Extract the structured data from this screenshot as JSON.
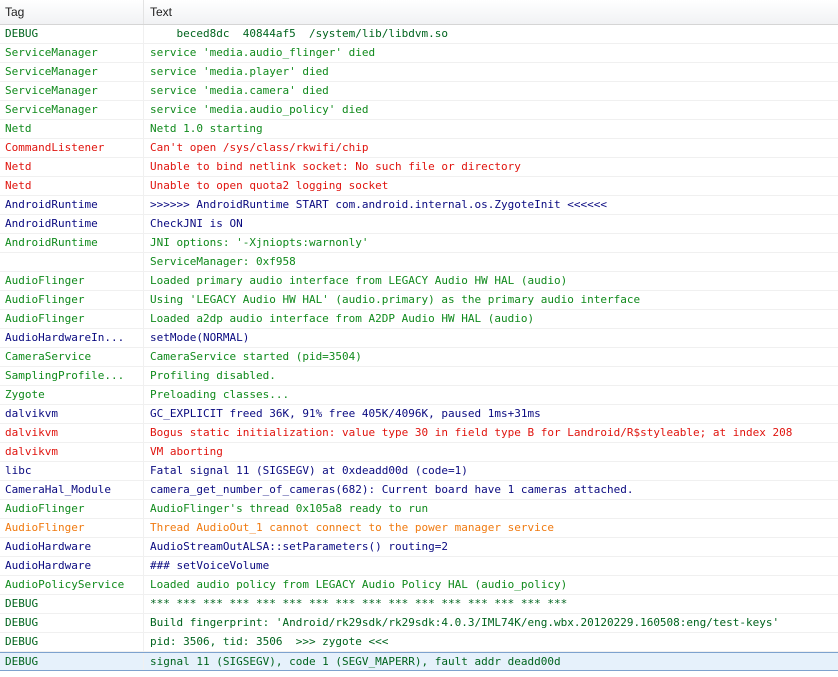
{
  "header": {
    "tag": "Tag",
    "text": "Text"
  },
  "rows": [
    {
      "tag": "DEBUG",
      "text": "    beced8dc  40844af5  /system/lib/libdvm.so",
      "level": "D"
    },
    {
      "tag": "ServiceManager",
      "text": "service 'media.audio_flinger' died",
      "level": "I"
    },
    {
      "tag": "ServiceManager",
      "text": "service 'media.player' died",
      "level": "I"
    },
    {
      "tag": "ServiceManager",
      "text": "service 'media.camera' died",
      "level": "I"
    },
    {
      "tag": "ServiceManager",
      "text": "service 'media.audio_policy' died",
      "level": "I"
    },
    {
      "tag": "Netd",
      "text": "Netd 1.0 starting",
      "level": "I"
    },
    {
      "tag": "CommandListener",
      "text": "Can't open /sys/class/rkwifi/chip",
      "level": "E"
    },
    {
      "tag": "Netd",
      "text": "Unable to bind netlink socket: No such file or directory",
      "level": "E"
    },
    {
      "tag": "Netd",
      "text": "Unable to open quota2 logging socket",
      "level": "E"
    },
    {
      "tag": "AndroidRuntime",
      "text": ">>>>>> AndroidRuntime START com.android.internal.os.ZygoteInit <<<<<<",
      "level": "V"
    },
    {
      "tag": "AndroidRuntime",
      "text": "CheckJNI is ON",
      "level": "V"
    },
    {
      "tag": "AndroidRuntime",
      "text": "JNI options: '-Xjniopts:warnonly'",
      "level": "I"
    },
    {
      "tag": "",
      "text": "ServiceManager: 0xf958",
      "level": "I"
    },
    {
      "tag": "AudioFlinger",
      "text": "Loaded primary audio interface from LEGACY Audio HW HAL (audio)",
      "level": "I"
    },
    {
      "tag": "AudioFlinger",
      "text": "Using 'LEGACY Audio HW HAL' (audio.primary) as the primary audio interface",
      "level": "I"
    },
    {
      "tag": "AudioFlinger",
      "text": "Loaded a2dp audio interface from A2DP Audio HW HAL (audio)",
      "level": "I"
    },
    {
      "tag": "AudioHardwareIn...",
      "text": "setMode(NORMAL)",
      "level": "V"
    },
    {
      "tag": "CameraService",
      "text": "CameraService started (pid=3504)",
      "level": "I"
    },
    {
      "tag": "SamplingProfile...",
      "text": "Profiling disabled.",
      "level": "I"
    },
    {
      "tag": "Zygote",
      "text": "Preloading classes...",
      "level": "I"
    },
    {
      "tag": "dalvikvm",
      "text": "GC_EXPLICIT freed 36K, 91% free 405K/4096K, paused 1ms+31ms",
      "level": "V"
    },
    {
      "tag": "dalvikvm",
      "text": "Bogus static initialization: value type 30 in field type B for Landroid/R$styleable; at index 208",
      "level": "E"
    },
    {
      "tag": "dalvikvm",
      "text": "VM aborting",
      "level": "E"
    },
    {
      "tag": "libc",
      "text": "Fatal signal 11 (SIGSEGV) at 0xdeadd00d (code=1)",
      "level": "V"
    },
    {
      "tag": "CameraHal_Module",
      "text": "camera_get_number_of_cameras(682): Current board have 1 cameras attached.",
      "level": "V"
    },
    {
      "tag": "AudioFlinger",
      "text": "AudioFlinger's thread 0x105a8 ready to run",
      "level": "I"
    },
    {
      "tag": "AudioFlinger",
      "text": "Thread AudioOut_1 cannot connect to the power manager service",
      "level": "W"
    },
    {
      "tag": "AudioHardware",
      "text": "AudioStreamOutALSA::setParameters() routing=2",
      "level": "V"
    },
    {
      "tag": "AudioHardware",
      "text": "### setVoiceVolume",
      "level": "V"
    },
    {
      "tag": "AudioPolicyService",
      "text": "Loaded audio policy from LEGACY Audio Policy HAL (audio_policy)",
      "level": "I"
    },
    {
      "tag": "DEBUG",
      "text": "*** *** *** *** *** *** *** *** *** *** *** *** *** *** *** ***",
      "level": "D"
    },
    {
      "tag": "DEBUG",
      "text": "Build fingerprint: 'Android/rk29sdk/rk29sdk:4.0.3/IML74K/eng.wbx.20120229.160508:eng/test-keys'",
      "level": "D"
    },
    {
      "tag": "DEBUG",
      "text": "pid: 3506, tid: 3506  >>> zygote <<<",
      "level": "D"
    },
    {
      "tag": "DEBUG",
      "text": "signal 11 (SIGSEGV), code 1 (SEGV_MAPERR), fault addr deadd00d",
      "level": "D",
      "selected": true
    }
  ],
  "level_colors": {
    "D": "#00641e",
    "I": "#108a1c",
    "V": "#0a0a80",
    "E": "#e0140e",
    "W": "#f07a10"
  }
}
